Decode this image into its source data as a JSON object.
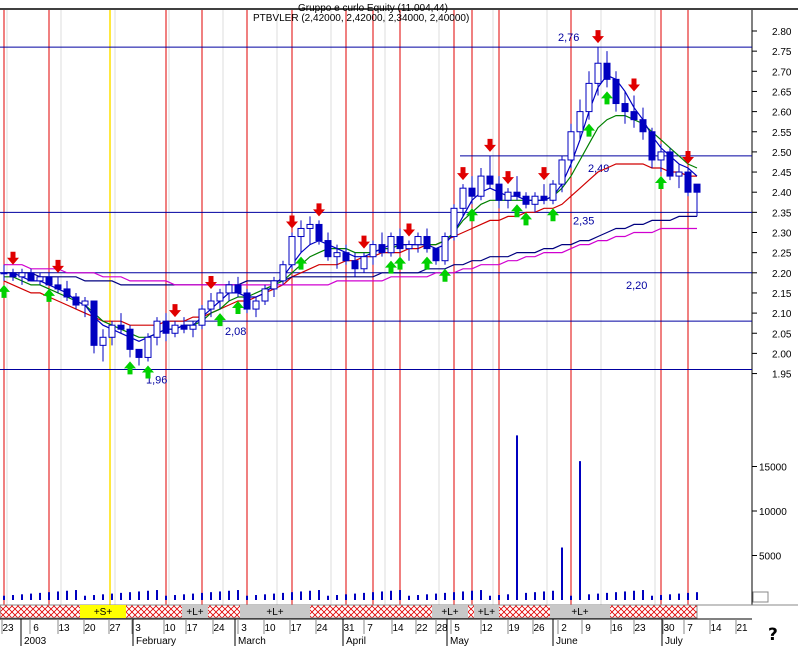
{
  "header": {
    "title_line1": "Gruppo e curlo Equity (11.004,44)",
    "title_line2": "PTBVLER (2,42000, 2,42000, 2,34000, 2,40000)"
  },
  "help_glyph": "?",
  "chart_data": [
    {
      "type": "candlestick",
      "title": "PTBVLER",
      "ylim": [
        1.9,
        2.85
      ],
      "y_ticks": [
        "2.80",
        "2.75",
        "2.70",
        "2.65",
        "2.60",
        "2.55",
        "2.50",
        "2.45",
        "2.40",
        "2.35",
        "2.30",
        "2.25",
        "2.20",
        "2.15",
        "2.10",
        "2.05",
        "2.00",
        "1.95"
      ],
      "grid": false,
      "levels": [
        {
          "value": 2.76,
          "label": "2,76"
        },
        {
          "value": 2.49,
          "label": "2,49"
        },
        {
          "value": 2.35,
          "label": "2,35"
        },
        {
          "value": 2.2,
          "label": "2,20"
        },
        {
          "value": 2.08,
          "label": "2,08"
        },
        {
          "value": 1.96,
          "label": "1,96"
        }
      ],
      "ohlc": [
        [
          2.2,
          2.22,
          2.18,
          2.2
        ],
        [
          2.2,
          2.21,
          2.18,
          2.19
        ],
        [
          2.19,
          2.21,
          2.17,
          2.2
        ],
        [
          2.2,
          2.21,
          2.18,
          2.18
        ],
        [
          2.18,
          2.2,
          2.17,
          2.19
        ],
        [
          2.19,
          2.2,
          2.17,
          2.17
        ],
        [
          2.17,
          2.19,
          2.15,
          2.16
        ],
        [
          2.16,
          2.18,
          2.13,
          2.14
        ],
        [
          2.14,
          2.15,
          2.11,
          2.12
        ],
        [
          2.12,
          2.14,
          2.09,
          2.13
        ],
        [
          2.13,
          2.13,
          2.0,
          2.02
        ],
        [
          2.02,
          2.06,
          1.98,
          2.04
        ],
        [
          2.04,
          2.08,
          2.02,
          2.07
        ],
        [
          2.07,
          2.1,
          2.05,
          2.06
        ],
        [
          2.06,
          2.07,
          1.99,
          2.01
        ],
        [
          2.01,
          2.0,
          1.97,
          1.99
        ],
        [
          1.99,
          2.05,
          1.98,
          2.04
        ],
        [
          2.04,
          2.09,
          2.02,
          2.08
        ],
        [
          2.08,
          2.1,
          2.03,
          2.05
        ],
        [
          2.05,
          2.08,
          2.04,
          2.07
        ],
        [
          2.07,
          2.09,
          2.05,
          2.06
        ],
        [
          2.06,
          2.08,
          2.04,
          2.07
        ],
        [
          2.07,
          2.12,
          2.06,
          2.11
        ],
        [
          2.11,
          2.15,
          2.09,
          2.13
        ],
        [
          2.13,
          2.16,
          2.11,
          2.15
        ],
        [
          2.15,
          2.18,
          2.13,
          2.17
        ],
        [
          2.17,
          2.19,
          2.14,
          2.15
        ],
        [
          2.15,
          2.16,
          2.1,
          2.11
        ],
        [
          2.11,
          2.14,
          2.09,
          2.13
        ],
        [
          2.13,
          2.17,
          2.12,
          2.16
        ],
        [
          2.16,
          2.19,
          2.14,
          2.18
        ],
        [
          2.18,
          2.23,
          2.17,
          2.22
        ],
        [
          2.22,
          2.3,
          2.21,
          2.29
        ],
        [
          2.29,
          2.33,
          2.25,
          2.31
        ],
        [
          2.31,
          2.34,
          2.27,
          2.32
        ],
        [
          2.32,
          2.33,
          2.27,
          2.28
        ],
        [
          2.28,
          2.3,
          2.23,
          2.24
        ],
        [
          2.24,
          2.27,
          2.21,
          2.25
        ],
        [
          2.25,
          2.27,
          2.22,
          2.23
        ],
        [
          2.23,
          2.25,
          2.19,
          2.21
        ],
        [
          2.21,
          2.25,
          2.2,
          2.24
        ],
        [
          2.24,
          2.28,
          2.22,
          2.27
        ],
        [
          2.27,
          2.3,
          2.24,
          2.25
        ],
        [
          2.25,
          2.3,
          2.24,
          2.29
        ],
        [
          2.29,
          2.31,
          2.25,
          2.26
        ],
        [
          2.26,
          2.28,
          2.23,
          2.27
        ],
        [
          2.27,
          2.3,
          2.25,
          2.29
        ],
        [
          2.29,
          2.31,
          2.25,
          2.26
        ],
        [
          2.26,
          2.26,
          2.22,
          2.23
        ],
        [
          2.23,
          2.3,
          2.22,
          2.29
        ],
        [
          2.29,
          2.37,
          2.28,
          2.36
        ],
        [
          2.36,
          2.42,
          2.34,
          2.41
        ],
        [
          2.41,
          2.44,
          2.37,
          2.39
        ],
        [
          2.39,
          2.46,
          2.38,
          2.44
        ],
        [
          2.44,
          2.49,
          2.41,
          2.42
        ],
        [
          2.42,
          2.44,
          2.36,
          2.38
        ],
        [
          2.38,
          2.41,
          2.36,
          2.4
        ],
        [
          2.4,
          2.44,
          2.38,
          2.39
        ],
        [
          2.39,
          2.4,
          2.36,
          2.37
        ],
        [
          2.37,
          2.4,
          2.35,
          2.39
        ],
        [
          2.39,
          2.42,
          2.37,
          2.38
        ],
        [
          2.38,
          2.43,
          2.37,
          2.42
        ],
        [
          2.42,
          2.49,
          2.4,
          2.48
        ],
        [
          2.48,
          2.57,
          2.46,
          2.55
        ],
        [
          2.55,
          2.63,
          2.53,
          2.6
        ],
        [
          2.6,
          2.7,
          2.58,
          2.67
        ],
        [
          2.67,
          2.76,
          2.64,
          2.72
        ],
        [
          2.72,
          2.75,
          2.66,
          2.68
        ],
        [
          2.68,
          2.7,
          2.6,
          2.62
        ],
        [
          2.62,
          2.65,
          2.57,
          2.6
        ],
        [
          2.6,
          2.64,
          2.56,
          2.58
        ],
        [
          2.58,
          2.61,
          2.53,
          2.55
        ],
        [
          2.55,
          2.56,
          2.46,
          2.48
        ],
        [
          2.48,
          2.52,
          2.45,
          2.5
        ],
        [
          2.5,
          2.51,
          2.43,
          2.44
        ],
        [
          2.44,
          2.47,
          2.41,
          2.45
        ],
        [
          2.45,
          2.46,
          2.39,
          2.4
        ],
        [
          2.42,
          2.42,
          2.34,
          2.4
        ]
      ],
      "series": [
        {
          "name": "",
          "color": "#d00000",
          "values": [
            2.18,
            2.17,
            2.16,
            2.15,
            2.15,
            2.14,
            2.13,
            2.12,
            2.11,
            2.1,
            2.09,
            2.08,
            2.08,
            2.08,
            2.07,
            2.07,
            2.07,
            2.07,
            2.08,
            2.08,
            2.08,
            2.09,
            2.09,
            2.1,
            2.11,
            2.12,
            2.13,
            2.13,
            2.14,
            2.15,
            2.16,
            2.17,
            2.19,
            2.2,
            2.21,
            2.22,
            2.22,
            2.22,
            2.23,
            2.23,
            2.24,
            2.24,
            2.25,
            2.25,
            2.25,
            2.26,
            2.26,
            2.27,
            2.27,
            2.28,
            2.29,
            2.3,
            2.31,
            2.32,
            2.33,
            2.33,
            2.34,
            2.34,
            2.35,
            2.35,
            2.36,
            2.36,
            2.37,
            2.39,
            2.41,
            2.43,
            2.45,
            2.46,
            2.47,
            2.47,
            2.47,
            2.47,
            2.46,
            2.46,
            2.45,
            2.45,
            2.44,
            2.44
          ]
        },
        {
          "name": "",
          "color": "#008000",
          "values": [
            2.19,
            2.19,
            2.18,
            2.17,
            2.17,
            2.16,
            2.15,
            2.14,
            2.13,
            2.12,
            2.1,
            2.08,
            2.07,
            2.06,
            2.05,
            2.04,
            2.04,
            2.05,
            2.06,
            2.06,
            2.07,
            2.07,
            2.08,
            2.1,
            2.11,
            2.13,
            2.14,
            2.14,
            2.15,
            2.16,
            2.17,
            2.18,
            2.2,
            2.22,
            2.24,
            2.25,
            2.26,
            2.26,
            2.26,
            2.25,
            2.25,
            2.25,
            2.26,
            2.26,
            2.27,
            2.27,
            2.27,
            2.27,
            2.27,
            2.28,
            2.3,
            2.33,
            2.35,
            2.37,
            2.38,
            2.38,
            2.38,
            2.38,
            2.38,
            2.38,
            2.38,
            2.39,
            2.41,
            2.44,
            2.48,
            2.52,
            2.56,
            2.58,
            2.59,
            2.59,
            2.58,
            2.57,
            2.55,
            2.53,
            2.51,
            2.49,
            2.47,
            2.46
          ]
        },
        {
          "name": "",
          "color": "#0000c0",
          "values": [
            2.2,
            2.2,
            2.19,
            2.18,
            2.18,
            2.17,
            2.16,
            2.15,
            2.13,
            2.12,
            2.09,
            2.07,
            2.06,
            2.05,
            2.04,
            2.03,
            2.04,
            2.05,
            2.06,
            2.06,
            2.07,
            2.07,
            2.09,
            2.11,
            2.13,
            2.15,
            2.15,
            2.14,
            2.14,
            2.15,
            2.17,
            2.19,
            2.22,
            2.25,
            2.27,
            2.28,
            2.27,
            2.26,
            2.25,
            2.24,
            2.24,
            2.25,
            2.26,
            2.27,
            2.27,
            2.27,
            2.27,
            2.27,
            2.26,
            2.27,
            2.3,
            2.34,
            2.38,
            2.4,
            2.41,
            2.4,
            2.39,
            2.39,
            2.38,
            2.38,
            2.38,
            2.39,
            2.42,
            2.47,
            2.53,
            2.6,
            2.66,
            2.69,
            2.68,
            2.65,
            2.61,
            2.58,
            2.54,
            2.51,
            2.49,
            2.47,
            2.46,
            2.44
          ]
        },
        {
          "name": "",
          "color": "#000080",
          "values": [
            2.2,
            2.2,
            2.2,
            2.2,
            2.19,
            2.19,
            2.19,
            2.19,
            2.19,
            2.18,
            2.18,
            2.18,
            2.18,
            2.17,
            2.17,
            2.17,
            2.17,
            2.17,
            2.17,
            2.17,
            2.17,
            2.17,
            2.17,
            2.17,
            2.17,
            2.17,
            2.17,
            2.18,
            2.18,
            2.18,
            2.18,
            2.18,
            2.19,
            2.19,
            2.19,
            2.19,
            2.19,
            2.19,
            2.19,
            2.19,
            2.19,
            2.19,
            2.2,
            2.2,
            2.2,
            2.2,
            2.2,
            2.21,
            2.21,
            2.21,
            2.22,
            2.22,
            2.23,
            2.23,
            2.24,
            2.24,
            2.24,
            2.25,
            2.25,
            2.25,
            2.26,
            2.26,
            2.27,
            2.27,
            2.28,
            2.28,
            2.29,
            2.3,
            2.31,
            2.31,
            2.32,
            2.32,
            2.33,
            2.33,
            2.33,
            2.34,
            2.34,
            2.34
          ]
        },
        {
          "name": "",
          "color": "#d000d0",
          "values": [
            2.22,
            2.22,
            2.22,
            2.21,
            2.21,
            2.21,
            2.21,
            2.2,
            2.2,
            2.2,
            2.2,
            2.19,
            2.19,
            2.19,
            2.18,
            2.18,
            2.18,
            2.18,
            2.18,
            2.17,
            2.17,
            2.17,
            2.17,
            2.17,
            2.17,
            2.17,
            2.17,
            2.17,
            2.17,
            2.17,
            2.17,
            2.17,
            2.17,
            2.17,
            2.17,
            2.17,
            2.17,
            2.18,
            2.18,
            2.18,
            2.18,
            2.18,
            2.18,
            2.19,
            2.19,
            2.19,
            2.19,
            2.19,
            2.2,
            2.2,
            2.2,
            2.21,
            2.21,
            2.22,
            2.22,
            2.22,
            2.23,
            2.23,
            2.24,
            2.24,
            2.25,
            2.25,
            2.25,
            2.26,
            2.27,
            2.27,
            2.28,
            2.28,
            2.29,
            2.29,
            2.3,
            2.3,
            2.3,
            2.31,
            2.31,
            2.31,
            2.31,
            2.31
          ]
        }
      ],
      "sell_signals": [
        1,
        6,
        19,
        23,
        32,
        35,
        40,
        45,
        51,
        54,
        56,
        60,
        66,
        70,
        76
      ],
      "buy_signals": [
        0,
        5,
        14,
        16,
        24,
        26,
        33,
        43,
        44,
        47,
        49,
        52,
        57,
        58,
        61,
        65,
        67,
        73
      ],
      "red_vlines": [
        0,
        5,
        18,
        22,
        27,
        32,
        38,
        41,
        44,
        50,
        52,
        55,
        63,
        73,
        76
      ],
      "yellow_vlines": [
        12
      ]
    },
    {
      "type": "bar",
      "title": "Volume",
      "ylim": [
        0,
        19000
      ],
      "y_ticks": [
        "15000",
        "10000",
        "5000"
      ],
      "volume_peaks": [
        {
          "index": 57,
          "value": 18500
        },
        {
          "index": 62,
          "value": 5900
        },
        {
          "index": 64,
          "value": 15600
        }
      ],
      "baseline_volume": 800
    }
  ],
  "timeline": {
    "segment_labels": [
      {
        "label": "+S+",
        "highlight": true
      },
      {
        "label": "+L+",
        "highlight": false
      },
      {
        "label": "+L+",
        "highlight": false
      },
      {
        "label": "+L+",
        "highlight": false
      },
      {
        "label": "+L+",
        "highlight": false
      },
      {
        "label": "+L+",
        "highlight": false
      }
    ],
    "day_ticks": [
      "23",
      "6",
      "13",
      "20",
      "27",
      "3",
      "10",
      "17",
      "24",
      "3",
      "10",
      "17",
      "24",
      "31",
      "7",
      "14",
      "22",
      "28",
      "5",
      "12",
      "19",
      "26",
      "2",
      "9",
      "16",
      "23",
      "30",
      "7",
      "14",
      "21"
    ],
    "months": [
      "2003",
      "February",
      "March",
      "April",
      "May",
      "June",
      "July"
    ],
    "colors": {
      "band": "#c8c8c8",
      "hatch": "#e00000",
      "highlight": "#ffff00"
    }
  }
}
